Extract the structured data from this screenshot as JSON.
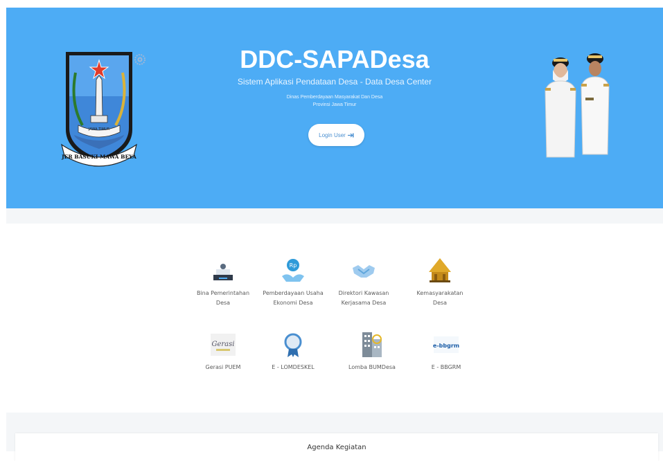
{
  "hero": {
    "title": "DDC-SAPADesa",
    "subtitle": "Sistem Aplikasi Pendataan Desa - Data Desa Center",
    "org_line1": "Dinas Pemberdayaan Masyarakat Dan Desa",
    "org_line2": "Provinsi Jawa Timur",
    "login_label": "Login User",
    "background": "#4dacf5"
  },
  "logo": {
    "ribbon_text": "JER BASUKI MAWA BEYA",
    "banner_text": "JAWA TIMUR"
  },
  "menu": {
    "row1": [
      {
        "label": "Bina Pemerintahan\nDesa",
        "icon": "government-icon"
      },
      {
        "label": "Pemberdayaan Usaha\nEkonomi Desa",
        "icon": "economy-icon"
      },
      {
        "label": "Direktori Kawasan\nKerjasama Desa",
        "icon": "handshake-icon"
      },
      {
        "label": "Kemasyarakatan\nDesa",
        "icon": "community-house-icon"
      }
    ],
    "row2": [
      {
        "label": "Gerasi PUEM",
        "icon": "gerasi-logo-icon",
        "icon_text": "Gerasi"
      },
      {
        "label": "E - LOMDESKEL",
        "icon": "award-ribbon-icon"
      },
      {
        "label": "Lomba BUMDesa",
        "icon": "buildings-icon"
      },
      {
        "label": "E - BBGRM",
        "icon": "ebbgrm-logo-icon",
        "icon_text": "e-bbgrm"
      }
    ]
  },
  "agenda": {
    "title": "Agenda Kegiatan"
  }
}
